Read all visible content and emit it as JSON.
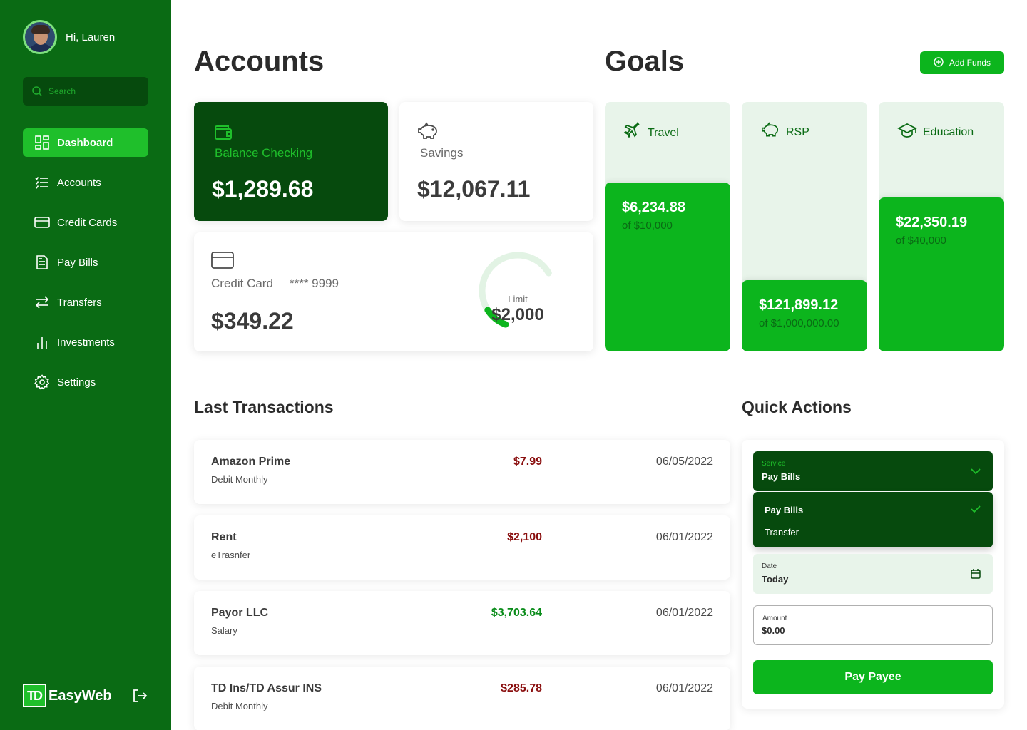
{
  "user": {
    "greeting": "Hi, Lauren"
  },
  "search": {
    "placeholder": "Search"
  },
  "sidebar": {
    "items": [
      {
        "label": "Dashboard",
        "icon": "dashboard-icon",
        "active": true
      },
      {
        "label": "Accounts",
        "icon": "list-icon"
      },
      {
        "label": "Credit Cards",
        "icon": "credit-card-icon"
      },
      {
        "label": "Pay Bills",
        "icon": "document-icon"
      },
      {
        "label": "Transfers",
        "icon": "transfer-icon"
      },
      {
        "label": "Investments",
        "icon": "bar-chart-icon"
      },
      {
        "label": "Settings",
        "icon": "gear-icon"
      }
    ]
  },
  "brand": {
    "logo": "TD",
    "name": "EasyWeb"
  },
  "accounts": {
    "title": "Accounts",
    "checking": {
      "label": "Balance Checking",
      "amount": "$1,289.68",
      "icon": "wallet-icon"
    },
    "savings": {
      "label": "Savings",
      "amount": "$12,067.11",
      "icon": "piggy-bank-icon"
    },
    "credit": {
      "label": "Credit Card",
      "masked": "**** 9999",
      "amount": "$349.22",
      "limit_label": "Limit",
      "limit_value": "$2,000",
      "utilization": 0.17,
      "icon": "credit-card-icon"
    }
  },
  "goals": {
    "title": "Goals",
    "add_funds_label": "Add Funds",
    "items": [
      {
        "label": "Travel",
        "icon": "airplane-icon",
        "value": "$6,234.88",
        "target": "of $10,000",
        "progress": 0.62
      },
      {
        "label": "RSP",
        "icon": "piggy-bank-icon",
        "value": "$121,899.12",
        "target": "of $1,000,000.00",
        "progress": 0.12
      },
      {
        "label": "Education",
        "icon": "graduation-cap-icon",
        "value": "$22,350.19",
        "target": "of $40,000",
        "progress": 0.56
      }
    ]
  },
  "transactions": {
    "title": "Last Transactions",
    "items": [
      {
        "name": "Amazon Prime",
        "type": "Debit Monthly",
        "amount": "$7.99",
        "direction": "debit",
        "date": "06/05/2022"
      },
      {
        "name": "Rent",
        "type": "eTrasnfer",
        "amount": "$2,100",
        "direction": "debit",
        "date": "06/01/2022"
      },
      {
        "name": "Payor LLC",
        "type": "Salary",
        "amount": "$3,703.64",
        "direction": "credit",
        "date": "06/01/2022"
      },
      {
        "name": "TD Ins/TD Assur INS",
        "type": "Debit Monthly",
        "amount": "$285.78",
        "direction": "debit",
        "date": "06/01/2022"
      }
    ]
  },
  "quick_actions": {
    "title": "Quick Actions",
    "service": {
      "label": "Service",
      "value": "Pay Bills",
      "options": [
        "Pay Bills",
        "Transfer"
      ]
    },
    "date": {
      "label": "Date",
      "value": "Today"
    },
    "amount": {
      "label": "Amount",
      "value": "$0.00"
    },
    "submit_label": "Pay Payee"
  },
  "colors": {
    "sidebar": "#0a6b14",
    "dark_green": "#064a0d",
    "accent": "#0cb51d",
    "light_green": "#e8f4ea",
    "debit": "#8a0f0f",
    "credit": "#0a8c1a"
  }
}
